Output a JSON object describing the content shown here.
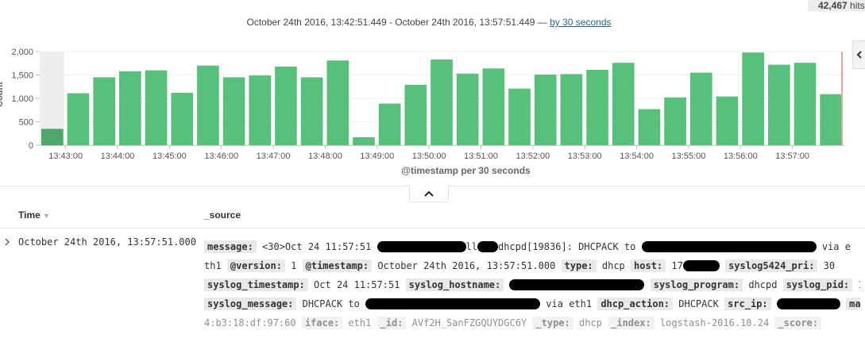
{
  "hits": {
    "count": "42,467",
    "label": "hits"
  },
  "time_range": {
    "text": "October 24th 2016, 13:42:51.449 - October 24th 2016, 13:57:51.449 —",
    "interval_link": "by 30 seconds"
  },
  "colors": {
    "bar": "#57c17b",
    "bar_partial": "#4ea86d",
    "partial_bg": "#eeeeee",
    "now_line": "#e8a0a0"
  },
  "chart_data": {
    "type": "bar",
    "title": "",
    "xlabel": "@timestamp per 30 seconds",
    "ylabel": "Count",
    "ylim": [
      0,
      2000
    ],
    "yticks": [
      "0",
      "500",
      "1,000",
      "1,500",
      "2,000"
    ],
    "grid": true,
    "categories": [
      "13:42:30",
      "13:43:00",
      "13:43:30",
      "13:44:00",
      "13:44:30",
      "13:45:00",
      "13:45:30",
      "13:46:00",
      "13:46:30",
      "13:47:00",
      "13:47:30",
      "13:48:00",
      "13:48:30",
      "13:49:00",
      "13:49:30",
      "13:50:00",
      "13:50:30",
      "13:51:00",
      "13:51:30",
      "13:52:00",
      "13:52:30",
      "13:53:00",
      "13:53:30",
      "13:54:00",
      "13:54:30",
      "13:55:00",
      "13:55:30",
      "13:56:00",
      "13:56:30",
      "13:57:00",
      "13:57:30"
    ],
    "values": [
      350,
      1110,
      1450,
      1580,
      1600,
      1120,
      1700,
      1450,
      1490,
      1680,
      1450,
      1810,
      170,
      890,
      1290,
      1830,
      1530,
      1640,
      1210,
      1510,
      1520,
      1610,
      1760,
      770,
      1020,
      1550,
      1040,
      1980,
      1720,
      1760,
      1090
    ],
    "xticks": [
      "13:43:00",
      "13:44:00",
      "13:45:00",
      "13:46:00",
      "13:47:00",
      "13:48:00",
      "13:49:00",
      "13:50:00",
      "13:51:00",
      "13:52:00",
      "13:53:00",
      "13:54:00",
      "13:55:00",
      "13:56:00",
      "13:57:00"
    ]
  },
  "table": {
    "col_time": "Time",
    "col_source": "_source",
    "row": {
      "time": "October 24th 2016, 13:57:51.000",
      "lines": [
        [
          {
            "k": "message:"
          },
          {
            "t": " <30>Oct 24 11:57:51 "
          },
          {
            "r": 112
          },
          {
            "t": "ll"
          },
          {
            "r": 26
          },
          {
            "t": "dhcpd[19836]: DHCPACK to "
          },
          {
            "r": 220
          },
          {
            "t": " via e"
          }
        ],
        [
          {
            "t": "th1 "
          },
          {
            "k": "@version:"
          },
          {
            "t": " 1 "
          },
          {
            "k": "@timestamp:"
          },
          {
            "t": " October 24th 2016, 13:57:51.000 "
          },
          {
            "k": "type:"
          },
          {
            "t": " dhcp "
          },
          {
            "k": "host:"
          },
          {
            "t": " 17"
          },
          {
            "r": 46
          },
          {
            "t": " "
          },
          {
            "k": "syslog5424_pri:"
          },
          {
            "t": " 30"
          }
        ],
        [
          {
            "k": "syslog_timestamp:"
          },
          {
            "t": " Oct 24 11:57:51 "
          },
          {
            "k": "syslog_hostname:"
          },
          {
            "t": " "
          },
          {
            "r": 170
          },
          {
            "t": " "
          },
          {
            "k": "syslog_program:"
          },
          {
            "t": " dhcpd "
          },
          {
            "k": "syslog_pid:"
          },
          {
            "t": " 19836"
          }
        ],
        [
          {
            "k": "syslog_message:"
          },
          {
            "t": " DHCPACK to "
          },
          {
            "r": 220
          },
          {
            "t": " via eth1 "
          },
          {
            "k": "dhcp_action:"
          },
          {
            "t": " DHCPACK "
          },
          {
            "k": "src_ip:"
          },
          {
            "t": " "
          },
          {
            "r": 80
          },
          {
            "t": " "
          },
          {
            "k": "mac:"
          },
          {
            "t": " e"
          }
        ],
        [
          {
            "t": "4:b3:18:df:97:60 "
          },
          {
            "k": "iface:"
          },
          {
            "t": " eth1 "
          },
          {
            "k": "_id:"
          },
          {
            "t": " AVf2H_SanFZGQUYDGC6Y "
          },
          {
            "k": "_type:"
          },
          {
            "t": " dhcp "
          },
          {
            "k": "_index:"
          },
          {
            "t": " logstash-2016.10.24 "
          },
          {
            "k": "_score:"
          }
        ]
      ]
    }
  }
}
